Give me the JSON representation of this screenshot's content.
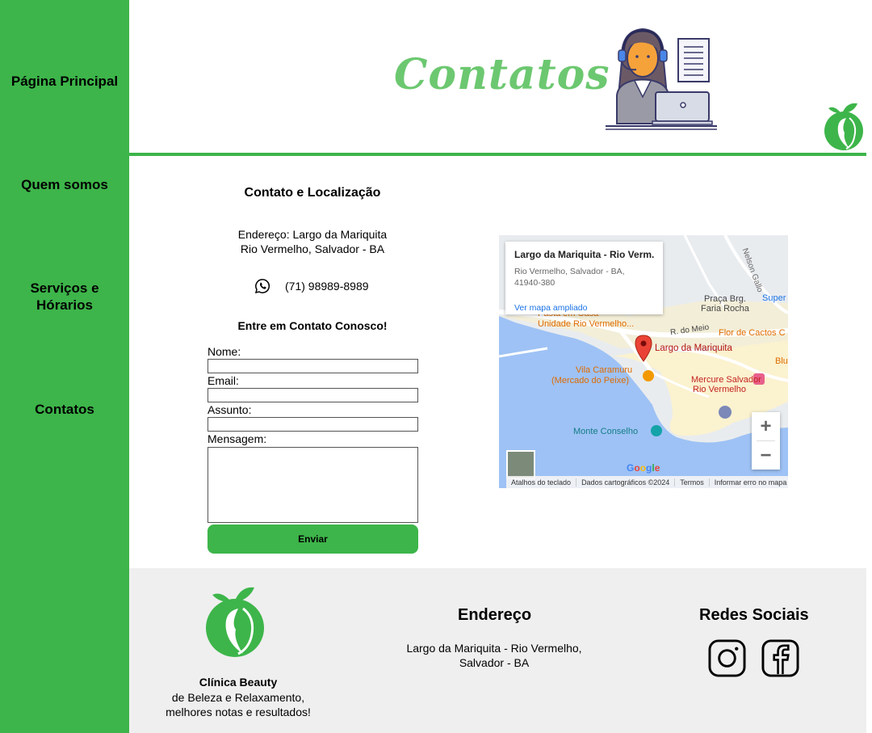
{
  "sidebar": {
    "items": [
      {
        "label": "Página Principal"
      },
      {
        "label": "Quem somos"
      },
      {
        "label": "Serviços e Hórarios"
      },
      {
        "label": "Contatos"
      }
    ]
  },
  "header": {
    "title": "Contatos"
  },
  "contact": {
    "section_title": "Contato e Localização",
    "address_line1": "Endereço: Largo da Mariquita",
    "address_line2": "Rio Vermelho, Salvador - BA",
    "phone": "(71) 98989-8989",
    "form_title": "Entre em Contato Conosco!",
    "name_label": "Nome:",
    "email_label": "Email:",
    "subject_label": "Assunto:",
    "message_label": "Mensagem:",
    "send_label": "Enviar"
  },
  "map": {
    "card_title": "Largo da Mariquita - Rio Verm...",
    "card_address1": "Rio Vermelho, Salvador - BA,",
    "card_address2": "41940-380",
    "card_link": "Ver mapa ampliado",
    "labels": {
      "pin": "Largo da Mariquita",
      "vila1": "Vila Caramuru",
      "vila2": "(Mercado do Peixe)",
      "mercure1": "Mercure Salvador",
      "mercure2": "Rio Vermelho",
      "monte": "Monte Conselho",
      "flor": "Flor de Cactos C",
      "praca1": "Praça Brg.",
      "praca2": "Faria Rocha",
      "super": "Super",
      "rmeio": "R. do Meio",
      "pasta1": "Pasta em Casa",
      "pasta2": "Unidade Rio Vermelho...",
      "blu": "Blu",
      "nelson": "Nelson Gallo"
    },
    "zoom_in": "+",
    "zoom_out": "−",
    "google": "Google",
    "footer": [
      "Atalhos do teclado",
      "Dados cartográficos ©2024",
      "Termos",
      "Informar erro no mapa"
    ]
  },
  "footer": {
    "clinic_name": "Clínica Beauty",
    "clinic_desc1": "de Beleza e Relaxamento,",
    "clinic_desc2": "melhores notas e resultados!",
    "address_title": "Endereço",
    "address_line1": "Largo da Mariquita - Rio Vermelho,",
    "address_line2": "Salvador - BA",
    "social_title": "Redes Sociais",
    "icons": [
      "instagram-icon",
      "facebook-icon"
    ]
  },
  "colors": {
    "brand_green": "#3db54a",
    "title_green": "#6cc870",
    "footer_bg": "#efefef"
  }
}
